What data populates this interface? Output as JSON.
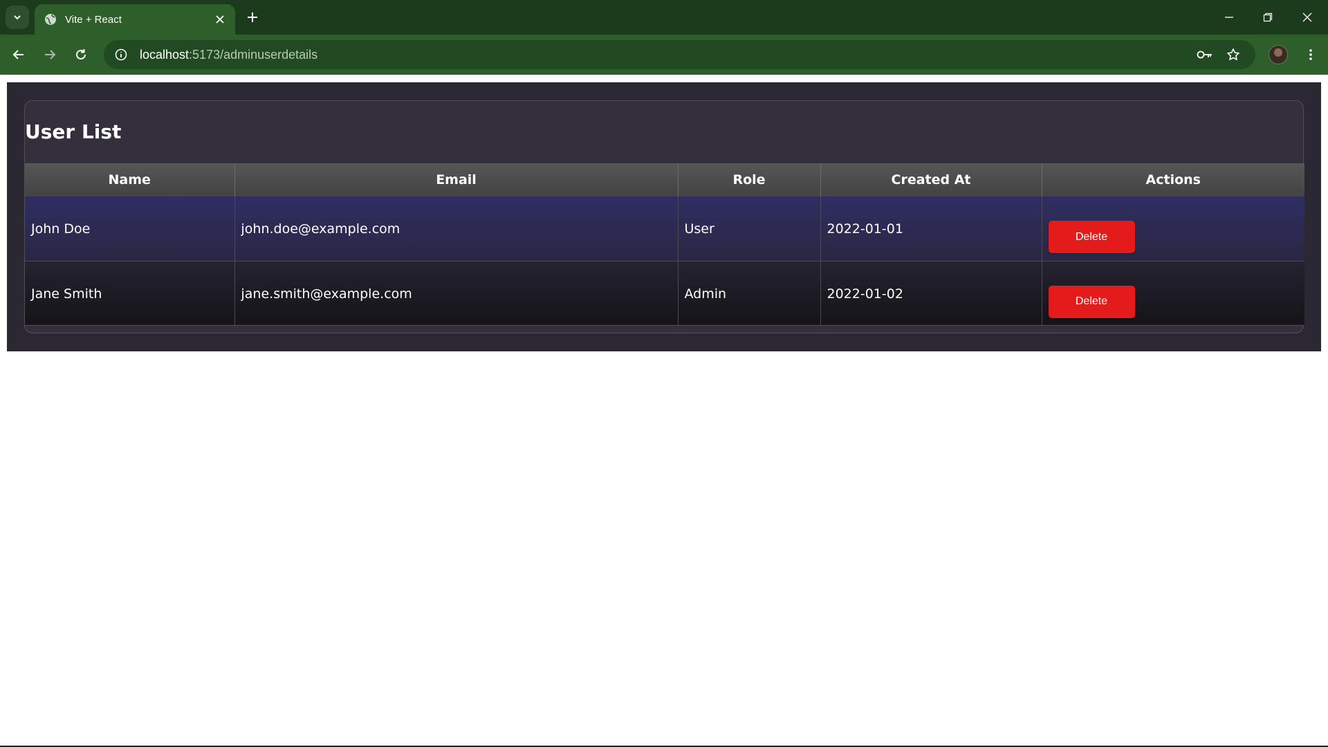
{
  "browser": {
    "tab_title": "Vite + React",
    "url_host": "localhost",
    "url_path": ":5173/adminuserdetails",
    "icons": [
      "tab-search-icon",
      "globe-icon",
      "close-icon",
      "plus-icon",
      "minimize-icon",
      "restore-icon",
      "window-close-icon",
      "back-icon",
      "forward-icon",
      "reload-icon",
      "info-icon",
      "key-icon",
      "star-icon",
      "avatar",
      "more-vert-icon"
    ]
  },
  "page": {
    "title": "User List",
    "columns": [
      "Name",
      "Email",
      "Role",
      "Created At",
      "Actions"
    ],
    "rows": [
      {
        "name": "John Doe",
        "email": "john.doe@example.com",
        "role": "User",
        "created_at": "2022-01-01",
        "action_label": "Delete"
      },
      {
        "name": "Jane Smith",
        "email": "jane.smith@example.com",
        "role": "Admin",
        "created_at": "2022-01-02",
        "action_label": "Delete"
      }
    ]
  },
  "colors": {
    "chrome_dark": "#1c3a1c",
    "chrome_green": "#2e5f2a",
    "panel_bg": "#2c2832",
    "header_gray": "#4d4d4d",
    "row_blue": "#2f2e63",
    "delete_red": "#e31b1b"
  }
}
